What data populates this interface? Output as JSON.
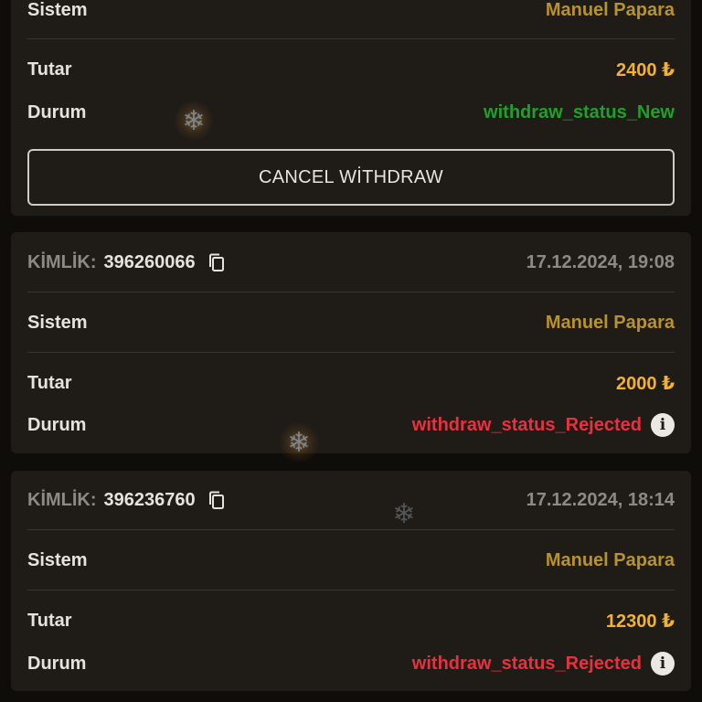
{
  "labels": {
    "system": "Sistem",
    "amount": "Tutar",
    "status": "Durum",
    "id_prefix": "KİMLİK:"
  },
  "cards": [
    {
      "system_value": "Manuel Papara",
      "amount": "2400 ₺",
      "status": "withdraw_status_New",
      "cancel_label": "CANCEL WİTHDRAW"
    },
    {
      "id": "396260066",
      "datetime": "17.12.2024, 19:08",
      "system_value": "Manuel Papara",
      "amount": "2000 ₺",
      "status": "withdraw_status_Rejected"
    },
    {
      "id": "396236760",
      "datetime": "17.12.2024, 18:14",
      "system_value": "Manuel Papara",
      "amount": "12300 ₺",
      "status": "withdraw_status_Rejected"
    }
  ],
  "icons": {
    "copy": "copy-icon",
    "info": "info-icon",
    "snowflake": "snowflake-icon"
  },
  "colors": {
    "background": "#0f0d0a",
    "card": "#1f1b17",
    "system": "#b8922a",
    "amount": "#f2b230",
    "status_new": "#1fa02c",
    "status_rejected": "#e8313f"
  }
}
